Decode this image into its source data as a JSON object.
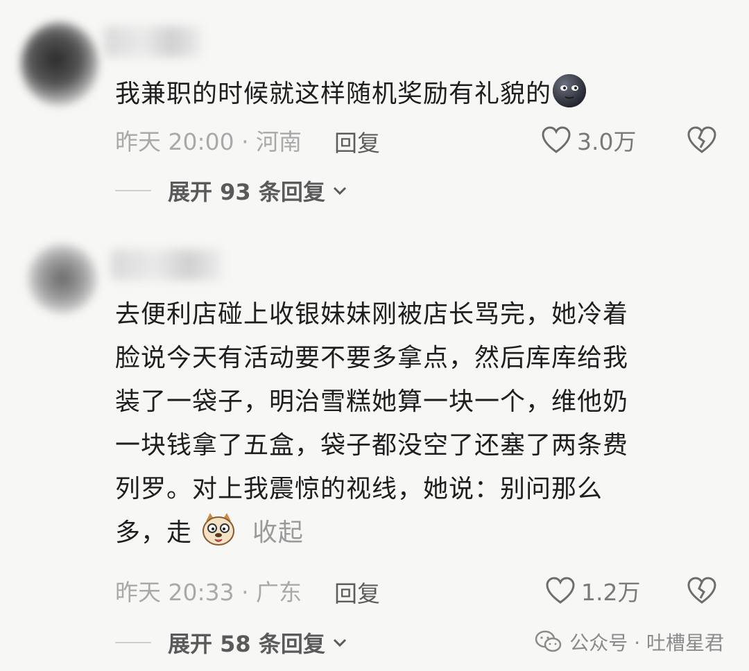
{
  "comments": [
    {
      "text": "我兼职的时候就这样随机奖励有礼貌的",
      "emoji": "dark-moon-face-emoji",
      "time_location": "昨天 20:00 · 河南",
      "reply_label": "回复",
      "likes": "3.0万",
      "expand_label": "展开 93 条回复"
    },
    {
      "lines": [
        "去便利店碰上收银妹妹刚被店长骂完，她冷着",
        "脸说今天有活动要不要多拿点，然后库库给我",
        "装了一袋子，明治雪糕她算一块一个，维他奶",
        "一块钱拿了五盒，袋子都没空了还塞了两条费",
        "列罗。对上我震惊的视线，她说：别问那么",
        "多，走"
      ],
      "emoji": "dog-face-emoji",
      "collapse_label": "收起",
      "time_location": "昨天 20:33 · 广东",
      "reply_label": "回复",
      "likes": "1.2万",
      "expand_label": "展开 58 条回复"
    }
  ],
  "watermark": "公众号 · 吐槽星君"
}
